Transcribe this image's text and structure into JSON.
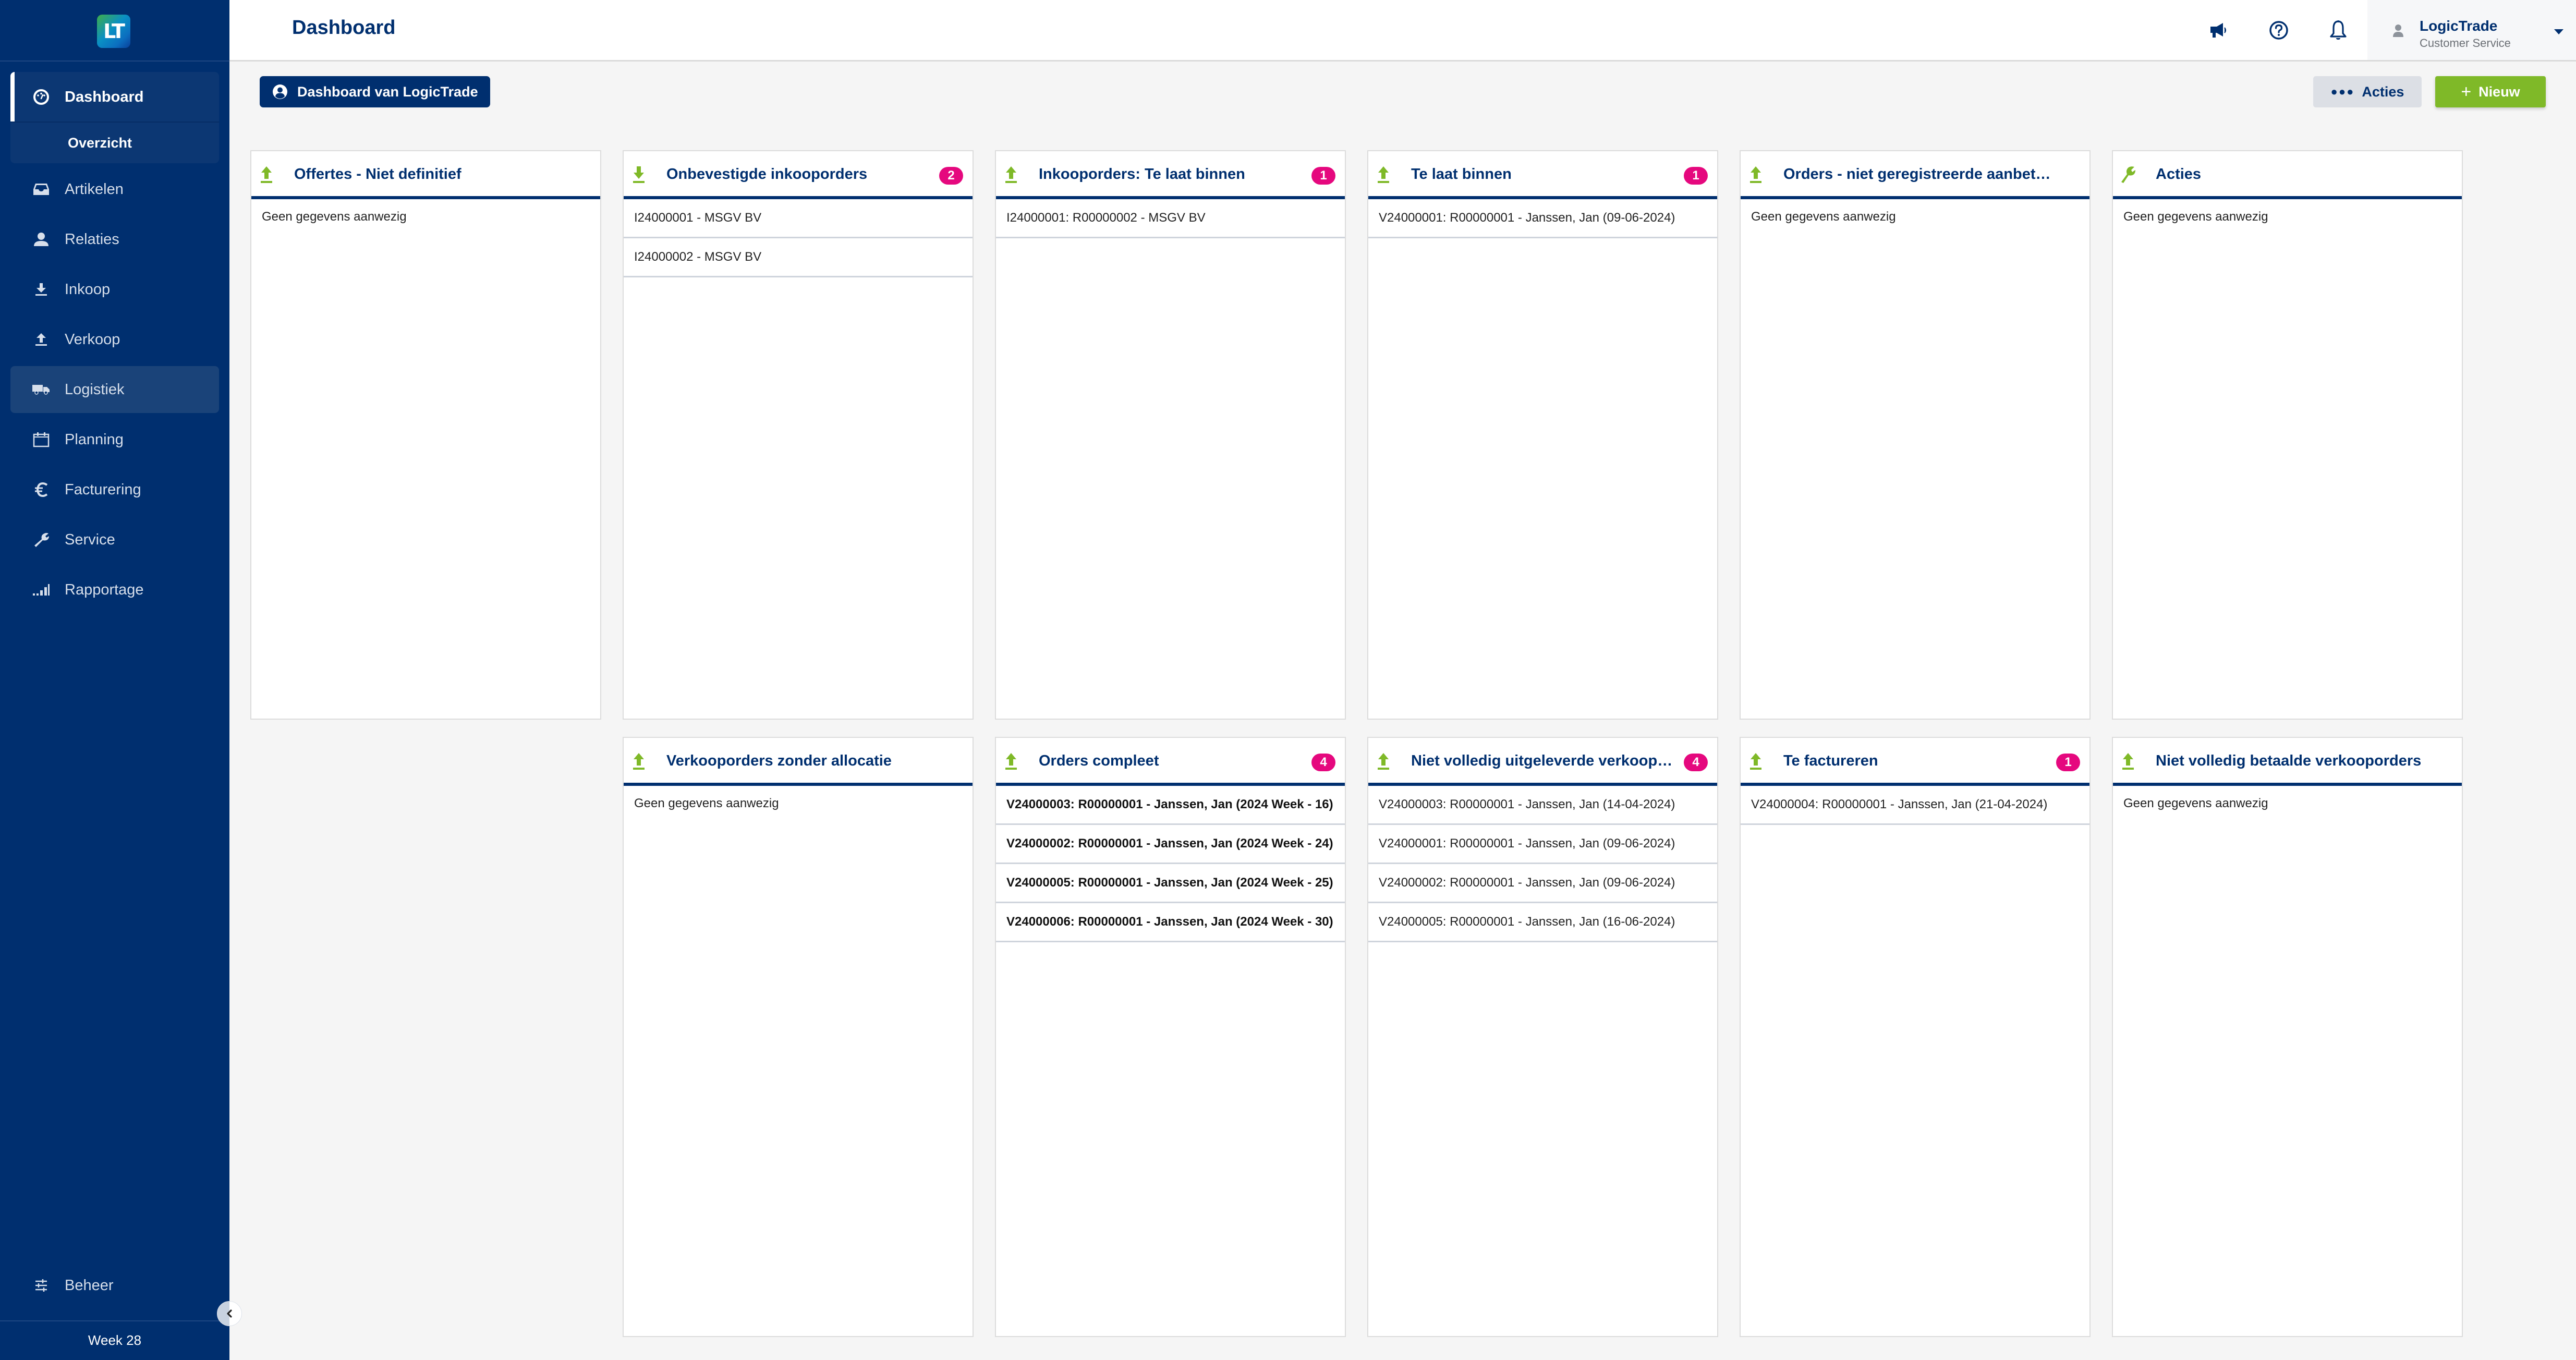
{
  "sidebar": {
    "logo_text": "LT",
    "nav_group": {
      "label": "Dashboard",
      "icon": "gauge-icon",
      "sub_items": [
        {
          "label": "Overzicht"
        }
      ]
    },
    "items": [
      {
        "label": "Artikelen",
        "icon": "inbox-icon"
      },
      {
        "label": "Relaties",
        "icon": "user-icon"
      },
      {
        "label": "Inkoop",
        "icon": "download-icon"
      },
      {
        "label": "Verkoop",
        "icon": "upload-icon"
      },
      {
        "label": "Logistiek",
        "icon": "truck-icon",
        "hovered": true
      },
      {
        "label": "Planning",
        "icon": "calendar-icon"
      },
      {
        "label": "Facturering",
        "icon": "euro-icon"
      },
      {
        "label": "Service",
        "icon": "wrench-icon"
      },
      {
        "label": "Rapportage",
        "icon": "signal-bars-icon"
      }
    ],
    "bottom_item": {
      "label": "Beheer",
      "icon": "sliders-icon"
    },
    "week_label": "Week 28"
  },
  "header": {
    "title": "Dashboard",
    "icons": [
      "megaphone-icon",
      "help-circle-icon",
      "bell-icon"
    ],
    "user": {
      "name": "LogicTrade",
      "role": "Customer Service"
    }
  },
  "toolbar": {
    "dashboard_selector": "Dashboard van LogicTrade",
    "acties_label": "Acties",
    "nieuw_label": "Nieuw"
  },
  "colors": {
    "primary": "#002f6f",
    "accent_green": "#7fb928",
    "badge": "#e5087e",
    "background": "#f5f5f5"
  },
  "widgets": {
    "top_row": [
      {
        "title": "Offertes - Niet definitief",
        "icon": "upload-arrow-icon",
        "badge": null,
        "empty_text": "Geen gegevens aanwezig",
        "items": []
      },
      {
        "title": "Onbevestigde inkooporders",
        "icon": "download-arrow-icon",
        "badge": "2",
        "items": [
          "I24000001 - MSGV BV",
          "I24000002 - MSGV BV"
        ]
      },
      {
        "title": "Inkooporders: Te laat binnen",
        "icon": "upload-arrow-icon",
        "badge": "1",
        "items": [
          "I24000001: R00000002 - MSGV BV"
        ]
      },
      {
        "title": "Te laat binnen",
        "icon": "upload-arrow-icon",
        "badge": "1",
        "items": [
          "V24000001: R00000001 - Janssen, Jan (09-06-2024)"
        ]
      },
      {
        "title": "Orders - niet geregistreerde aanbetalingen",
        "icon": "upload-arrow-icon",
        "badge": null,
        "empty_text": "Geen gegevens aanwezig",
        "items": []
      },
      {
        "title": "Acties",
        "icon": "wrench-icon",
        "badge": null,
        "empty_text": "Geen gegevens aanwezig",
        "items": []
      }
    ],
    "bottom_row": [
      {
        "title": "Verkooporders zonder allocatie",
        "icon": "upload-arrow-icon",
        "badge": null,
        "empty_text": "Geen gegevens aanwezig",
        "items": []
      },
      {
        "title": "Orders compleet",
        "icon": "upload-arrow-icon",
        "badge": "4",
        "bold": true,
        "items": [
          "V24000003: R00000001 - Janssen, Jan (2024 Week - 16)",
          "V24000002: R00000001 - Janssen, Jan (2024 Week - 24)",
          "V24000005: R00000001 - Janssen, Jan (2024 Week - 25)",
          "V24000006: R00000001 - Janssen, Jan (2024 Week - 30)"
        ]
      },
      {
        "title": "Niet volledig uitgeleverde verkooporders",
        "icon": "upload-arrow-icon",
        "badge": "4",
        "items": [
          "V24000003: R00000001 - Janssen, Jan (14-04-2024)",
          "V24000001: R00000001 - Janssen, Jan (09-06-2024)",
          "V24000002: R00000001 - Janssen, Jan (09-06-2024)",
          "V24000005: R00000001 - Janssen, Jan (16-06-2024)"
        ]
      },
      {
        "title": "Te factureren",
        "icon": "upload-arrow-icon",
        "badge": "1",
        "items": [
          "V24000004: R00000001 - Janssen, Jan (21-04-2024)"
        ]
      },
      {
        "title": "Niet volledig betaalde verkooporders",
        "icon": "upload-arrow-icon",
        "badge": null,
        "empty_text": "Geen gegevens aanwezig",
        "items": []
      }
    ]
  }
}
